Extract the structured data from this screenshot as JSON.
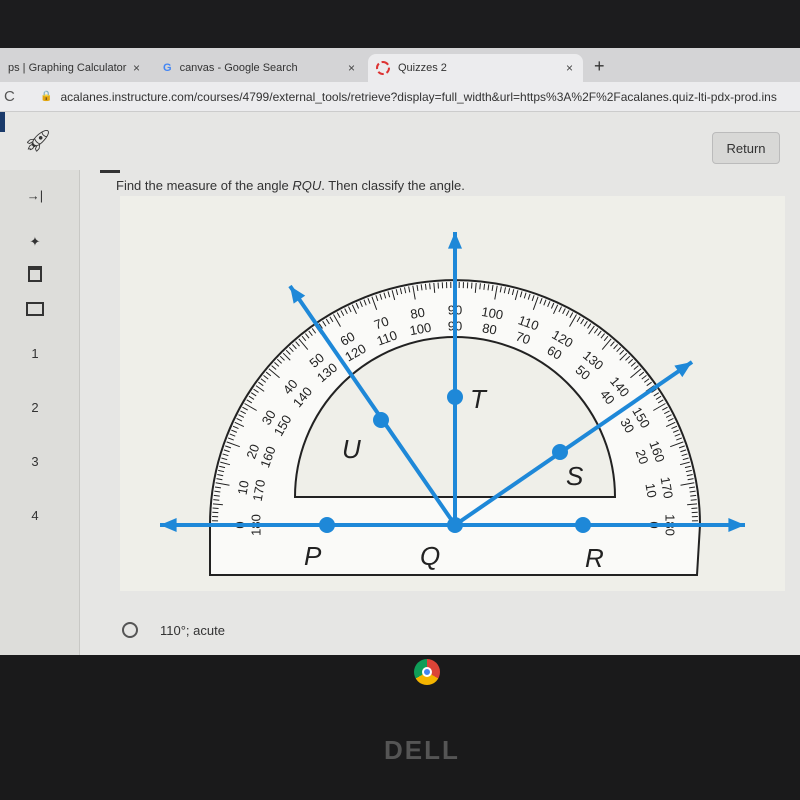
{
  "browser": {
    "tabs": [
      {
        "label": "ps | Graphing Calculator",
        "icon": "desmos-icon"
      },
      {
        "label": "canvas - Google Search",
        "icon": "google-icon"
      },
      {
        "label": "Quizzes 2",
        "icon": "quizzes-icon",
        "active": true
      }
    ],
    "close_glyph": "×",
    "new_tab_glyph": "+",
    "reload_glyph": "C",
    "url": "acalanes.instructure.com/courses/4799/external_tools/retrieve?display=full_width&url=https%3A%2F%2Facalanes.quiz-lti-pdx-prod.ins"
  },
  "header": {
    "return_label": "Return"
  },
  "sidebar": {
    "collapse_glyph": "→|",
    "questions": [
      "1",
      "2",
      "3",
      "4"
    ]
  },
  "question": {
    "text_before": "Find the measure of the angle ",
    "angle": "RQU",
    "text_after": ". Then classify the angle."
  },
  "figure": {
    "points": {
      "P": "P",
      "Q": "Q",
      "R": "R",
      "S": "S",
      "T": "T",
      "U": "U"
    },
    "outer_scale": [
      "0",
      "10",
      "20",
      "30",
      "40",
      "50",
      "60",
      "70",
      "80",
      "90",
      "100",
      "110",
      "120",
      "130",
      "140",
      "150",
      "160",
      "170",
      "180"
    ],
    "inner_scale": [
      "180",
      "170",
      "160",
      "150",
      "140",
      "130",
      "120",
      "110",
      "100",
      "90",
      "80",
      "70",
      "60",
      "50",
      "40",
      "30",
      "20",
      "10",
      "0"
    ],
    "ray_color": "#1e88d8"
  },
  "answers": [
    {
      "label": "110°; acute"
    }
  ],
  "device": {
    "brand": "DELL"
  }
}
